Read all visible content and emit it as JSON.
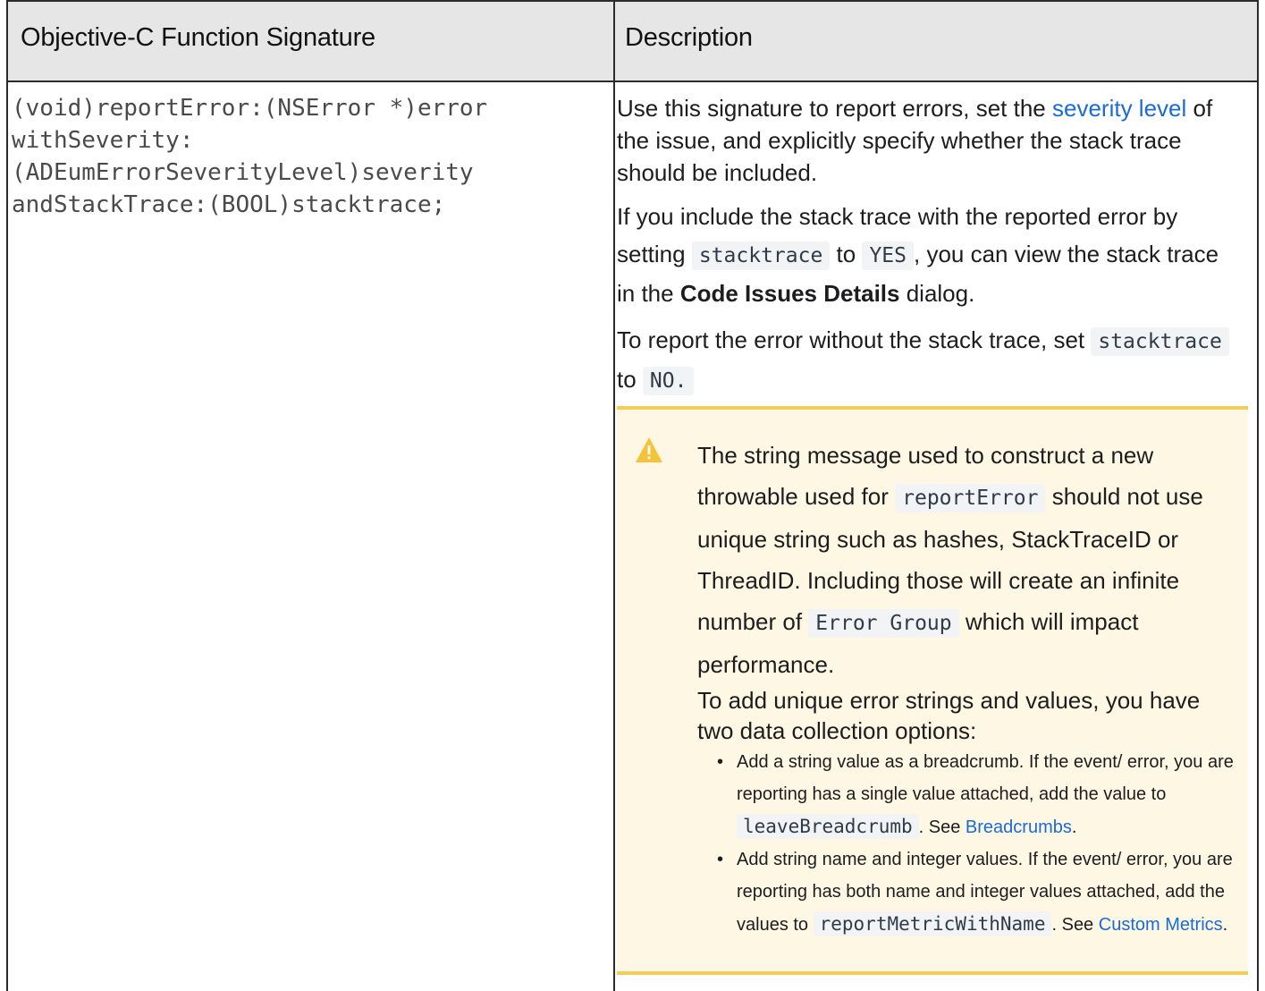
{
  "table": {
    "headers": [
      "Objective-C Function Signature",
      "Description"
    ],
    "signature_lines": [
      "(void)reportError:(NSError *)error",
      "withSeverity:",
      "(ADEumErrorSeverityLevel)severity",
      "andStackTrace:(BOOL)stacktrace;"
    ],
    "desc": {
      "p1_a": "Use this signature to report errors, set the ",
      "p1_link": "severity level",
      "p1_b": " of the issue, and explicitly specify whether the stack trace should be included.",
      "p2_a": "If you include the stack trace with the reported error by setting ",
      "p2_code1": "stacktrace",
      "p2_b": " to ",
      "p2_code2": "YES",
      "p2_c": ", you can view the stack trace in the ",
      "p2_bold": "Code Issues Details",
      "p2_d": " dialog.",
      "p3_a": "To report the error without the stack trace, set ",
      "p3_code1": "stacktrace",
      "p3_b": " to ",
      "p3_code2": "NO."
    },
    "note": {
      "icon": "warning-icon",
      "t1": "The string message used to construct a new throwable used for ",
      "t1_code": "reportError",
      "t2": " should not use unique string such as hashes, StackTraceID or ThreadID. Including those will create an infinite number of ",
      "t2_code": "Error Group",
      "t3": " which will impact performance.",
      "t4": "To add unique error strings and values, you have two data collection options:",
      "b1_a": "Add a string value as a breadcrumb. If the event/ error, you are reporting has a single value attached, add the value to ",
      "b1_code": "leaveBreadcrumb",
      "b1_b": ". See ",
      "b1_link": "Breadcrumbs",
      "b1_c": ".",
      "b2_a": "Add string name and integer values. If the event/ error, you are reporting has both name and integer values attached, add the values to ",
      "b2_code": "reportMetricWithName",
      "b2_b": ". See ",
      "b2_link": "Custom Metrics",
      "b2_c": "."
    }
  },
  "colors": {
    "border": "#2b2b2b",
    "header_bg": "#e6e6e6",
    "link": "#1a6bd6",
    "note_bg": "#fdf7e3",
    "note_border": "#f4cd58",
    "warn": "#f5c33b"
  }
}
